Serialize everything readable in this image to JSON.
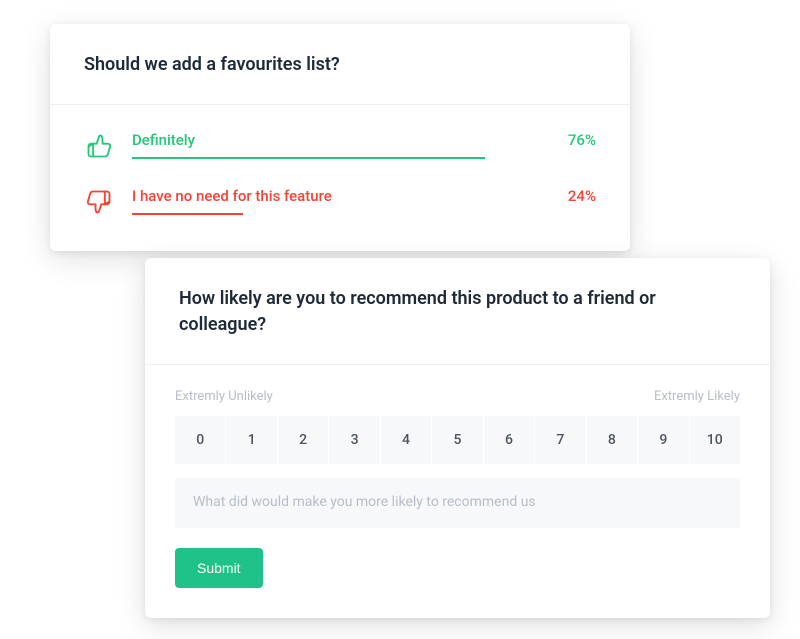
{
  "poll": {
    "title": "Should we add a favourites list?",
    "options": [
      {
        "label": "Definitely",
        "percent_label": "76%",
        "percent": 76,
        "color": "green",
        "icon": "thumb-up"
      },
      {
        "label": "I have no need for this feature",
        "percent_label": "24%",
        "percent": 24,
        "color": "red",
        "icon": "thumb-down"
      }
    ]
  },
  "nps": {
    "title": "How likely are you to recommend this product to a friend or colleague?",
    "low_label": "Extremly Unlikely",
    "high_label": "Extremly Likely",
    "scale": [
      "0",
      "1",
      "2",
      "3",
      "4",
      "5",
      "6",
      "7",
      "8",
      "9",
      "10"
    ],
    "feedback_placeholder": "What did would make you more likely to recommend us",
    "submit_label": "Submit"
  },
  "colors": {
    "green": "#22c879",
    "red": "#f44336",
    "submit": "#1fc38a"
  }
}
